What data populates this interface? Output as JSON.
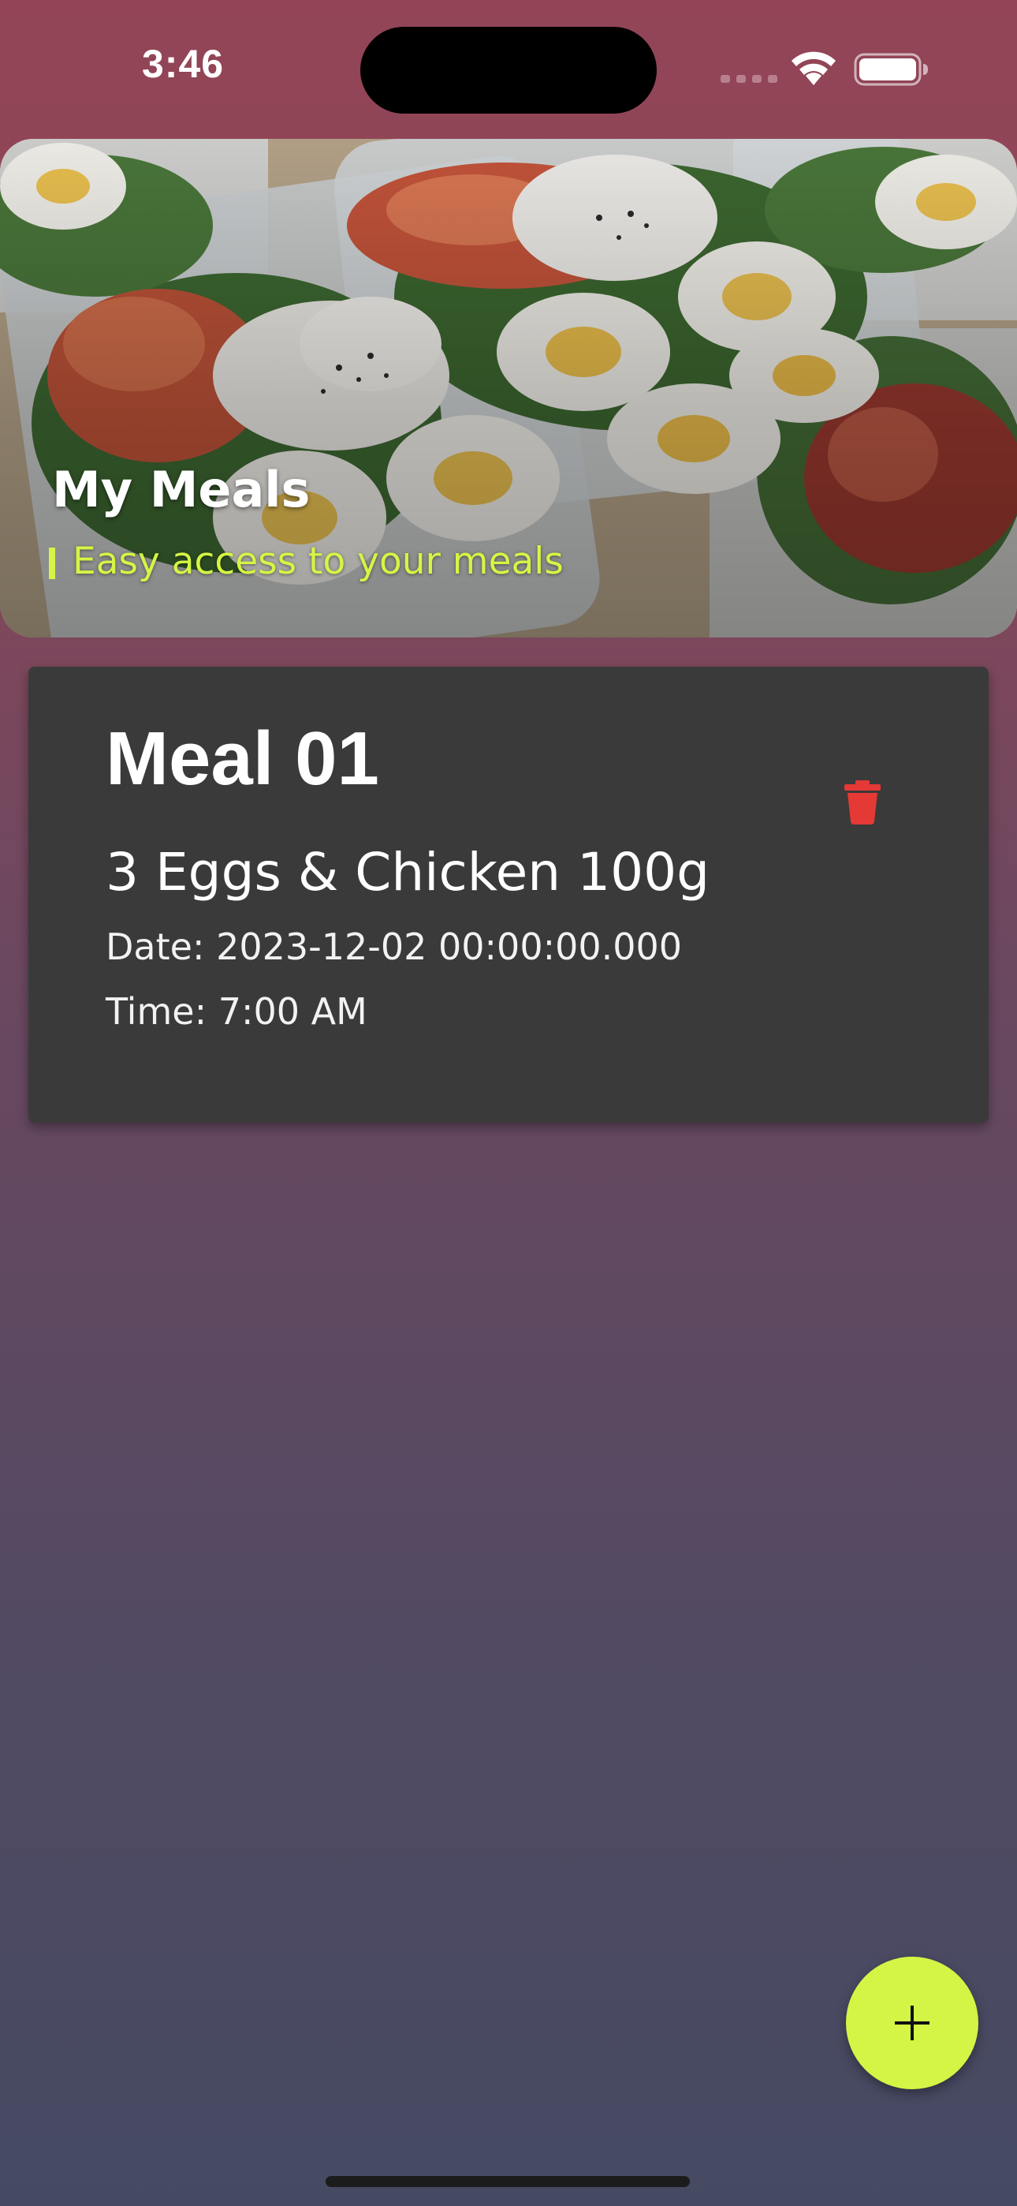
{
  "status_bar": {
    "time": "3:46",
    "icons": [
      "signal-icon",
      "wifi-icon",
      "battery-icon"
    ]
  },
  "header": {
    "title": "My Meals",
    "subtitle": "Easy access to your meals",
    "accent_color": "#d4f545"
  },
  "meals": [
    {
      "name": "Meal 01",
      "description": "3 Eggs & Chicken 100g",
      "date": "Date: 2023-12-02 00:00:00.000",
      "time": "Time: 7:00 AM",
      "delete_icon": "trash-icon",
      "delete_color": "#e53935"
    }
  ],
  "fab": {
    "icon": "plus-icon",
    "color": "#d4f545"
  },
  "colors": {
    "card_background": "#3a3a3a",
    "background_top": "#934556",
    "background_bottom": "#454a62"
  }
}
